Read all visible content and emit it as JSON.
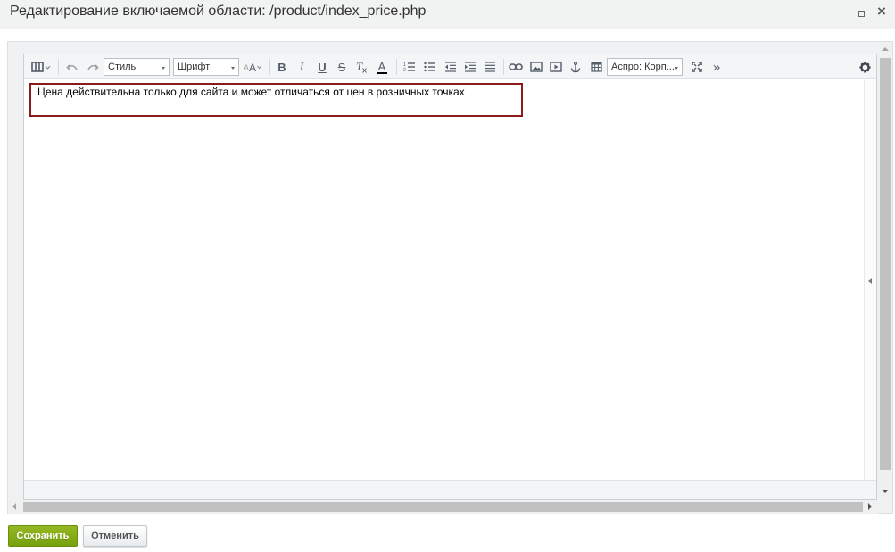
{
  "dialog": {
    "title": "Редактирование включаемой области: /product/index_price.php",
    "maximize_icon": "maximize-icon",
    "close_glyph": "×"
  },
  "toolbar": {
    "style_select": "Стиль",
    "font_select": "Шрифт",
    "font_size_icon": "font-size-icon",
    "bold": "B",
    "italic": "I",
    "underline": "U",
    "strike": "S",
    "remove_format": "T",
    "text_color": "A",
    "template_select": "Аспро: Корп...",
    "more": "»",
    "icons": [
      "view-mode-icon",
      "undo-icon",
      "redo-icon",
      "ordered-list-icon",
      "unordered-list-icon",
      "outdent-icon",
      "indent-icon",
      "align-icon",
      "link-icon",
      "image-icon",
      "video-icon",
      "anchor-icon",
      "table-icon",
      "fullscreen-icon",
      "settings-icon"
    ]
  },
  "content": {
    "text": "Цена действительна только для сайта и может отличаться от цен в розничных точках"
  },
  "footer": {
    "save_label": "Сохранить",
    "cancel_label": "Отменить"
  },
  "colors": {
    "save_button": "#7ba914",
    "highlight_border": "#8b1a1a",
    "toolbar_bg": "#f3f5f6"
  }
}
